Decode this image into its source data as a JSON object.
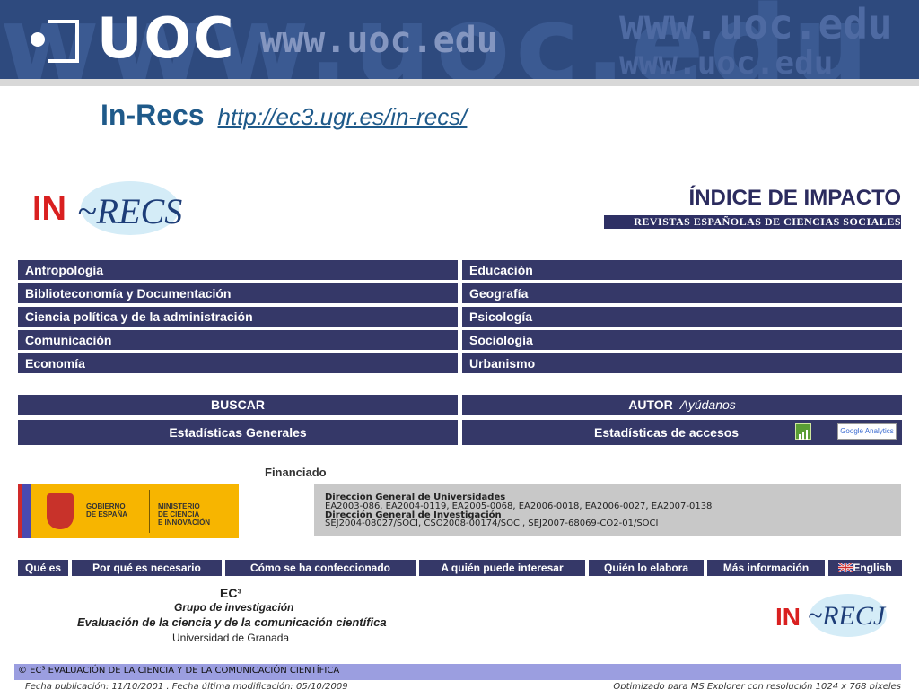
{
  "banner": {
    "brand": "UOC",
    "url": "www.uoc.edu",
    "bg_text": "www.uoc.edu"
  },
  "title": {
    "name": "In-Recs",
    "link": "http://ec3.ugr.es/in-recs/"
  },
  "logo": {
    "in": "IN",
    "recs": "~RECS"
  },
  "header": {
    "indice": "ÍNDICE DE IMPACTO",
    "revistas": "REVISTAS ESPAÑOLAS DE CIENCIAS SOCIALES"
  },
  "categories": {
    "left": [
      "Antropología",
      "Biblioteconomía y Documentación",
      "Ciencia política y de la administración",
      "Comunicación",
      "Economía"
    ],
    "right": [
      "Educación",
      "Geografía",
      "Psicología",
      "Sociología",
      "Urbanismo"
    ]
  },
  "actions": {
    "buscar": "BUSCAR",
    "autor": "AUTOR",
    "ayudanos": "Ayúdanos",
    "estadisticas_generales": "Estadísticas Generales",
    "estadisticas_accesos": "Estadísticas de accesos",
    "google_analytics": "Google Analytics"
  },
  "funding": {
    "financiado": "Financiado",
    "gob_line1": "GOBIERNO",
    "gob_line2": "DE ESPAÑA",
    "min_line1": "MINISTERIO",
    "min_line2": "DE CIENCIA",
    "min_line3": "E INNOVACIÓN",
    "dg_univ": "Dirección General de Universidades",
    "dg_univ_codes": "EA2003-086, EA2004-0119, EA2005-0068, EA2006-0018, EA2006-0027, EA2007-0138",
    "dg_inv": "Dirección General de Investigación",
    "dg_inv_codes": "SEJ2004-08027/SOCI, CSO2008-00174/SOCI, SEJ2007-68069-CO2-01/SOCI"
  },
  "nav": [
    "Qué es",
    "Por qué es necesario",
    "Cómo se ha confeccionado",
    "A quién puede interesar",
    "Quién lo elabora",
    "Más información",
    "English"
  ],
  "credits": {
    "ec3": "EC³",
    "grupo": "Grupo de investigación",
    "evaluacion": "Evaluación de la ciencia y de la comunicación científica",
    "universidad": "Universidad de Granada"
  },
  "logo2": {
    "in": "IN",
    "recj": "~RECJ"
  },
  "footer": {
    "copyright": "© EC³ EVALUACIÓN DE LA CIENCIA Y DE LA COMUNICACIÓN CIENTÍFICA",
    "publicacion": "Fecha publicación: 11/10/2001 . Fecha última modificación: 05/10/2009",
    "optimizado": "Optimizado para MS Explorer con resolución 1024 x 768 pixeles"
  },
  "colors": {
    "banner": "#2e4a7e",
    "cell": "#353868",
    "title": "#1f5a8a",
    "footer": "#9b9ee0"
  }
}
